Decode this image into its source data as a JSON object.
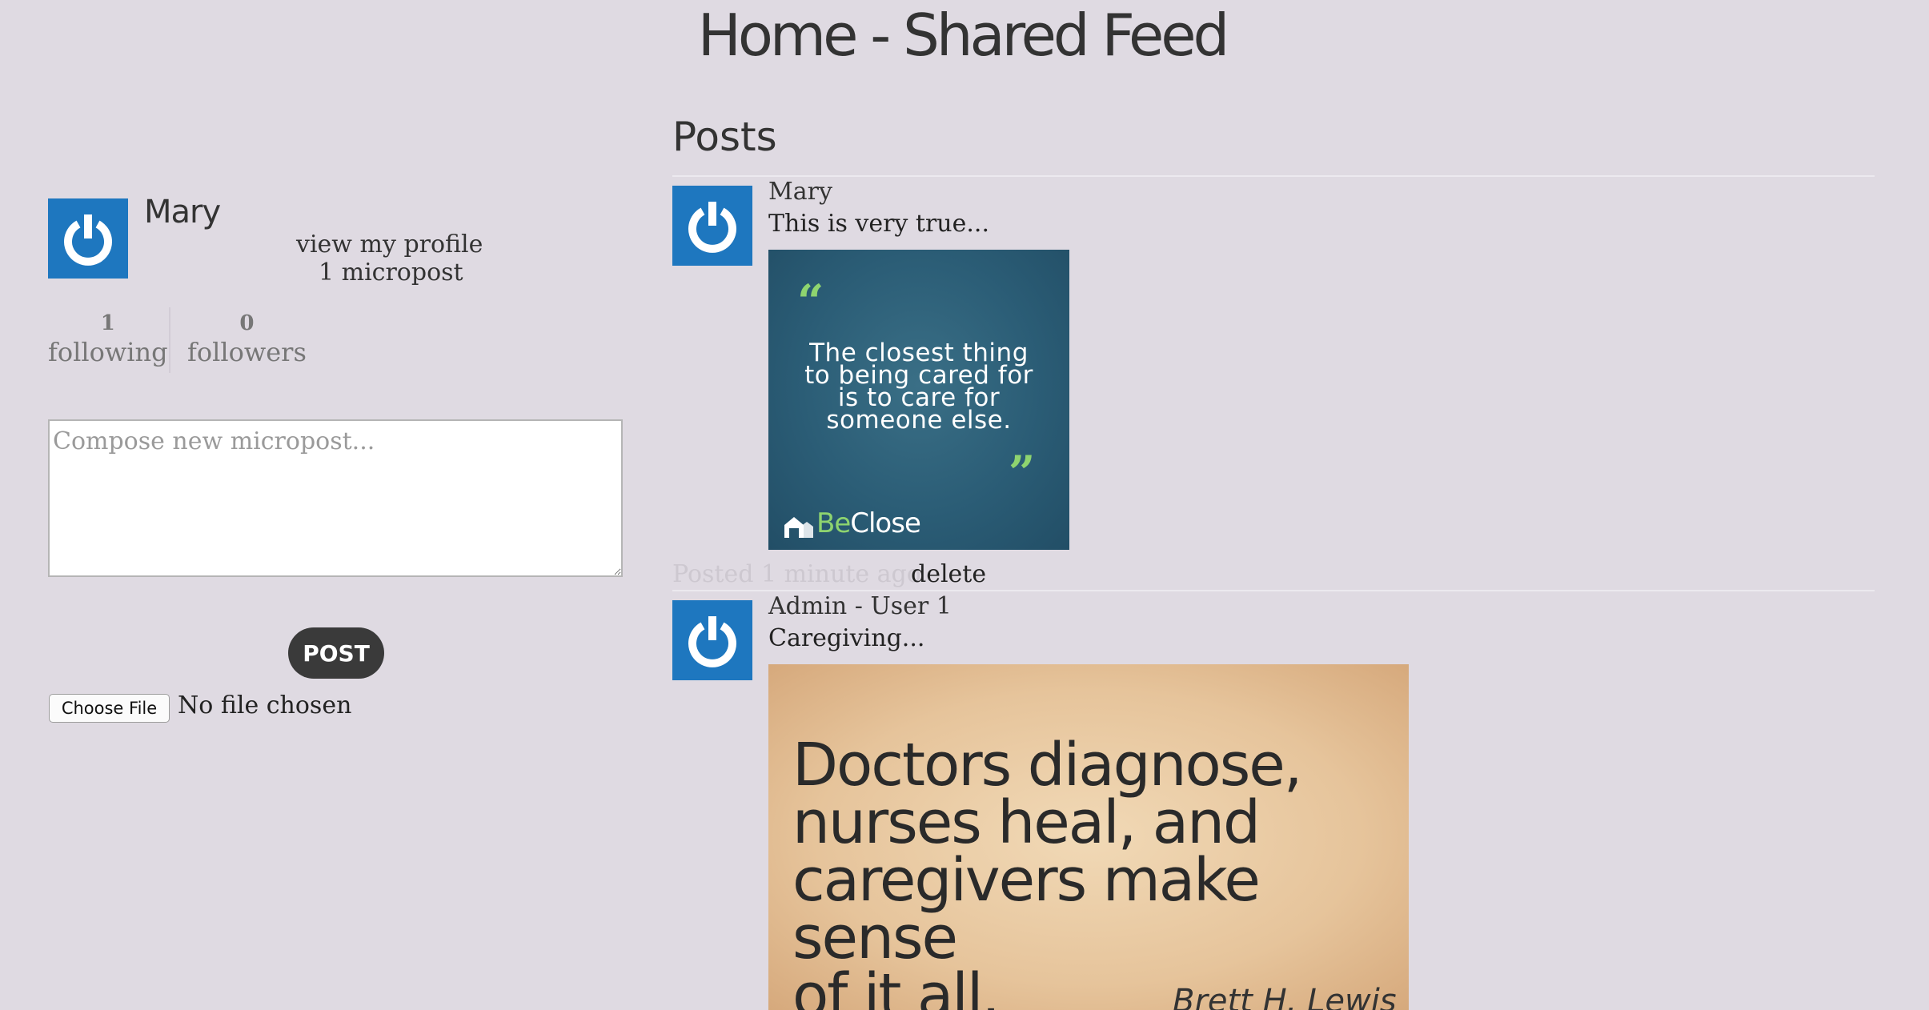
{
  "page": {
    "title": "Home - Shared Feed"
  },
  "sidebar": {
    "user_name": "Mary",
    "view_profile_label": "view my profile",
    "micropost_count": "1 micropost",
    "stats": {
      "following_count": "1",
      "following_label": "following",
      "followers_count": "0",
      "followers_label": "followers"
    },
    "compose": {
      "placeholder": "Compose new micropost...",
      "value": ""
    },
    "post_button_label": "POST",
    "file_picker": {
      "button_label": "Choose File",
      "status": "No file chosen"
    }
  },
  "feed": {
    "heading": "Posts",
    "posts": [
      {
        "author": "Mary",
        "text": "This is very true...",
        "image": {
          "quote_lines": [
            "The closest thing",
            "to being cared for",
            "is to care for",
            "someone else."
          ],
          "brand_prefix": "Be",
          "brand_suffix": "Close"
        },
        "timestamp": "Posted 1 minute ago.",
        "delete_label": "delete"
      },
      {
        "author": "Admin - User 1",
        "text": "Caregiving...",
        "image": {
          "quote_lines": [
            "Doctors diagnose,",
            "nurses heal, and",
            "caregivers make sense",
            "of it all."
          ],
          "author": "Brett H. Lewis"
        }
      }
    ]
  },
  "colors": {
    "background": "#dfdae2",
    "avatar": "#1e77bf",
    "button": "#3a3a3a",
    "accent_green": "#8ed46f"
  }
}
